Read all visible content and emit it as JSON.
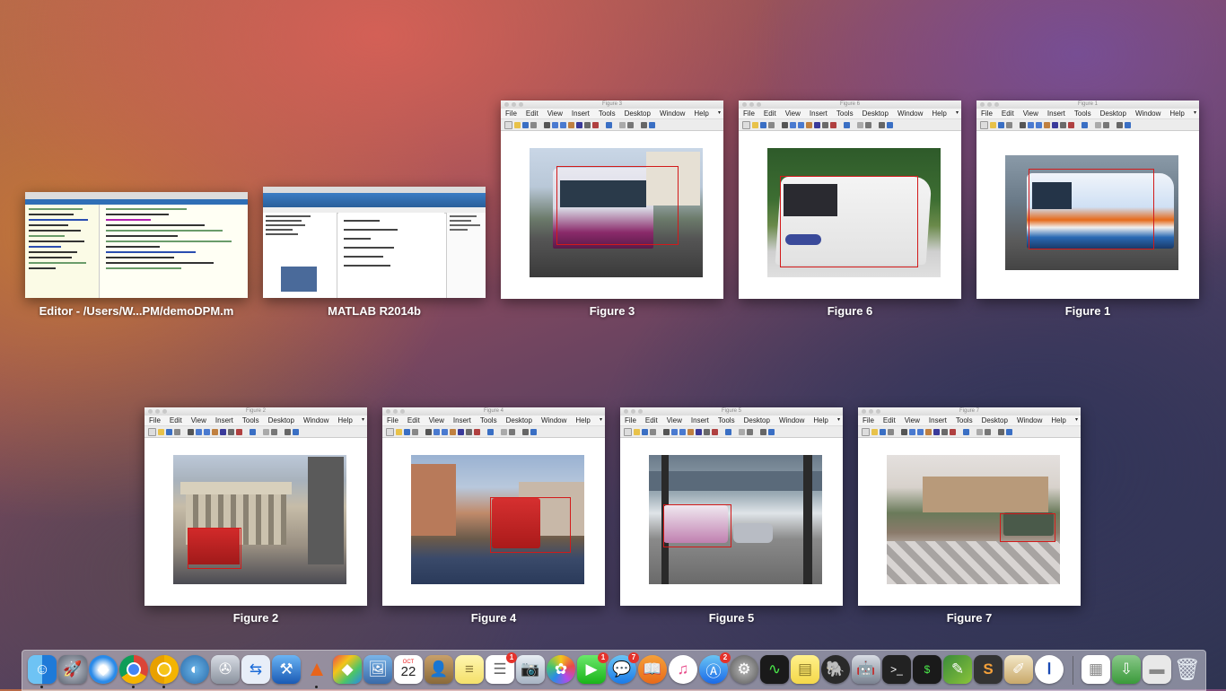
{
  "windows": {
    "editor": {
      "label": "Editor - /Users/W...PM/demoDPM.m"
    },
    "matlab": {
      "label": "MATLAB R2014b"
    },
    "figure3": {
      "label": "Figure 3",
      "title": "Figure 3"
    },
    "figure6": {
      "label": "Figure 6",
      "title": "Figure 6"
    },
    "figure1": {
      "label": "Figure 1",
      "title": "Figure 1"
    },
    "figure2": {
      "label": "Figure 2",
      "title": "Figure 2"
    },
    "figure4": {
      "label": "Figure 4",
      "title": "Figure 4"
    },
    "figure5": {
      "label": "Figure 5",
      "title": "Figure 5"
    },
    "figure7": {
      "label": "Figure 7",
      "title": "Figure 7"
    }
  },
  "figure_menu": [
    "File",
    "Edit",
    "View",
    "Insert",
    "Tools",
    "Desktop",
    "Window",
    "Help"
  ],
  "dock": {
    "calendar_day": "22",
    "calendar_month": "OCT",
    "badges": {
      "reminders": "1",
      "facetime": "1",
      "messages": "7",
      "app_store": "2"
    }
  },
  "colors": {
    "bbox": "#d21a1a",
    "dock_bg": "#cdcdd7"
  }
}
